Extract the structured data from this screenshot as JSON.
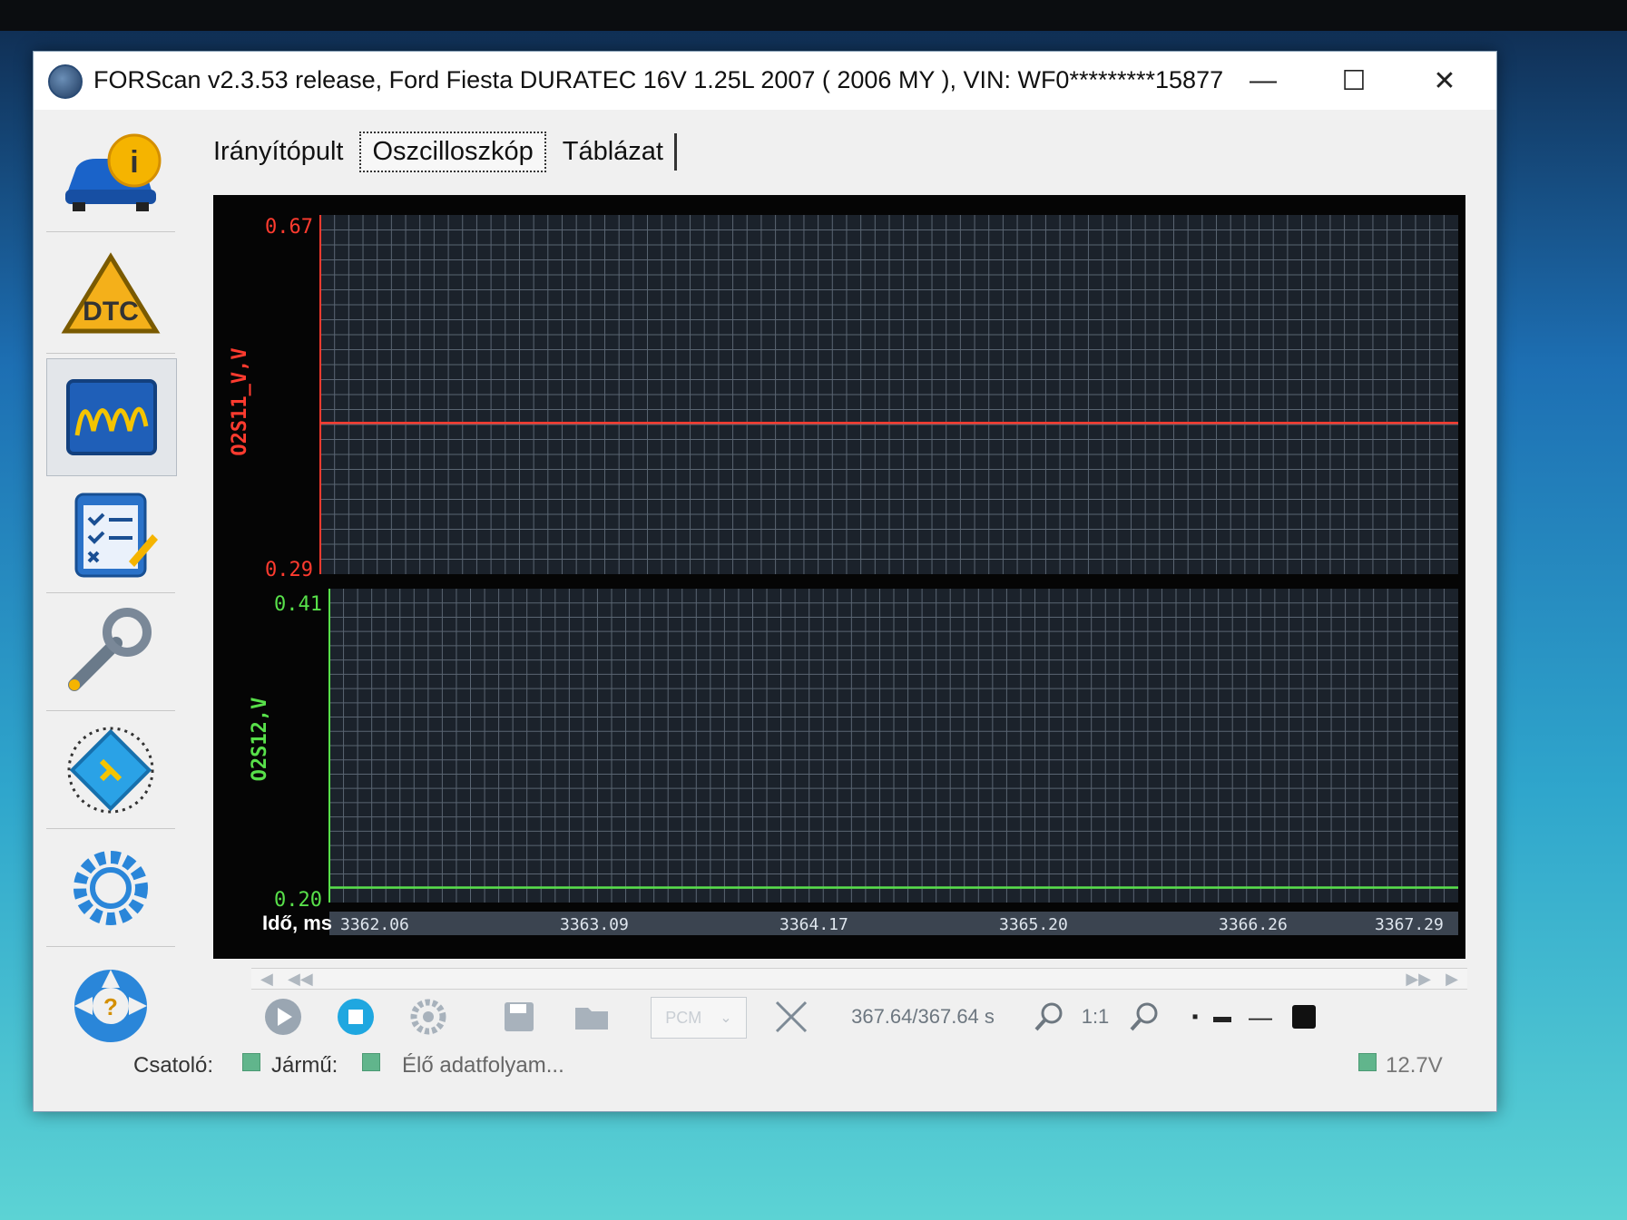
{
  "window": {
    "title": "FORScan v2.3.53 release, Ford Fiesta DURATEC 16V 1.25L 2007 ( 2006 MY ), VIN: WF0*********15877"
  },
  "sidebar": {
    "items": [
      {
        "name": "vehicle-info",
        "label": "i"
      },
      {
        "name": "dtc",
        "label": "DTC"
      },
      {
        "name": "oscilloscope"
      },
      {
        "name": "tests"
      },
      {
        "name": "service"
      },
      {
        "name": "configuration"
      },
      {
        "name": "settings"
      },
      {
        "name": "help",
        "label": "?"
      }
    ]
  },
  "tabs": [
    {
      "label": "Irányítópult"
    },
    {
      "label": "Oszcilloszkóp"
    },
    {
      "label": "Táblázat"
    }
  ],
  "chart_data": [
    {
      "type": "line",
      "series": [
        {
          "name": "O2S11_V,V",
          "color": "#ff3b2f",
          "ylim": [
            0.29,
            0.67
          ],
          "x": [
            3362.06,
            3363.09,
            3364.17,
            3365.2,
            3366.26,
            3367.29
          ],
          "values": [
            0.45,
            0.45,
            0.45,
            0.45,
            0.45,
            0.45
          ]
        }
      ]
    },
    {
      "type": "line",
      "series": [
        {
          "name": "O2S12,V",
          "color": "#58e04a",
          "ylim": [
            0.2,
            0.41
          ],
          "x": [
            3362.06,
            3363.09,
            3364.17,
            3365.2,
            3366.26,
            3367.29
          ],
          "values": [
            0.21,
            0.21,
            0.21,
            0.21,
            0.21,
            0.21
          ]
        }
      ]
    }
  ],
  "scope": {
    "red_label": "O2S11_V,V",
    "red_max": "0.67",
    "red_min": "0.29",
    "green_label": "O2S12,V",
    "green_max": "0.41",
    "green_min": "0.20",
    "x_label": "Idő, ms",
    "x_ticks": [
      "3362.06",
      "3363.09",
      "3364.17",
      "3365.20",
      "3366.26",
      "3367.29"
    ]
  },
  "toolbar": {
    "time_display": "367.64/367.64 s",
    "zoom_ratio": "1:1",
    "pcm_select": "PCM"
  },
  "status": {
    "interface_label": "Csatoló:",
    "vehicle_label": "Jármű:",
    "stream_text": "Élő adatfolyam...",
    "voltage": "12.7V"
  }
}
